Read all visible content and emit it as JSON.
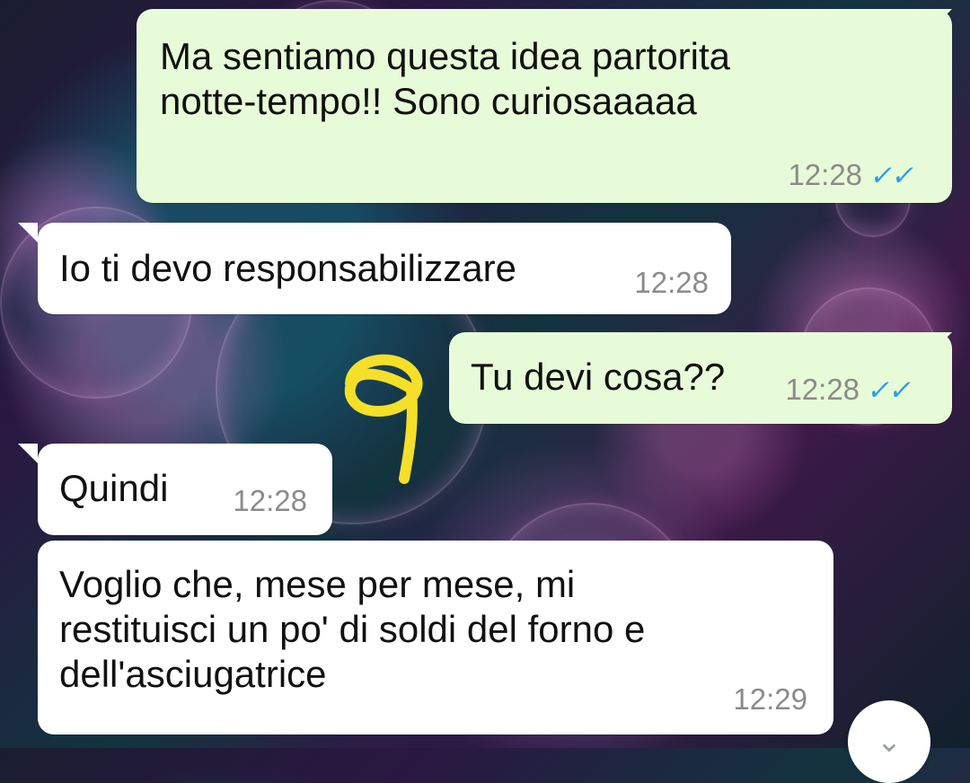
{
  "messages": [
    {
      "direction": "outgoing",
      "text": "Ma sentiamo questa idea partorita\nnotte-tempo!! Sono curiosaaaaa",
      "time": "12:28",
      "status_icon": "double-check-read"
    },
    {
      "direction": "incoming",
      "text": "Io ti devo responsabilizzare",
      "time": "12:28"
    },
    {
      "direction": "outgoing",
      "text": "Tu devi cosa??",
      "time": "12:28",
      "status_icon": "double-check-read"
    },
    {
      "direction": "incoming",
      "text": "Quindi",
      "time": "12:28"
    },
    {
      "direction": "incoming",
      "text": "Voglio che, mese per mese, mi\nrestituisci un po' di soldi del forno e\ndell'asciugatrice",
      "time": "12:29"
    }
  ],
  "icons": {
    "read_receipt": "double-check-icon",
    "scroll_down": "chevron-down-icon"
  },
  "colors": {
    "outgoing_bubble": "#e8fbd8",
    "incoming_bubble": "#ffffff",
    "read_check": "#2a9ee8",
    "annotation": "#f5df28"
  }
}
